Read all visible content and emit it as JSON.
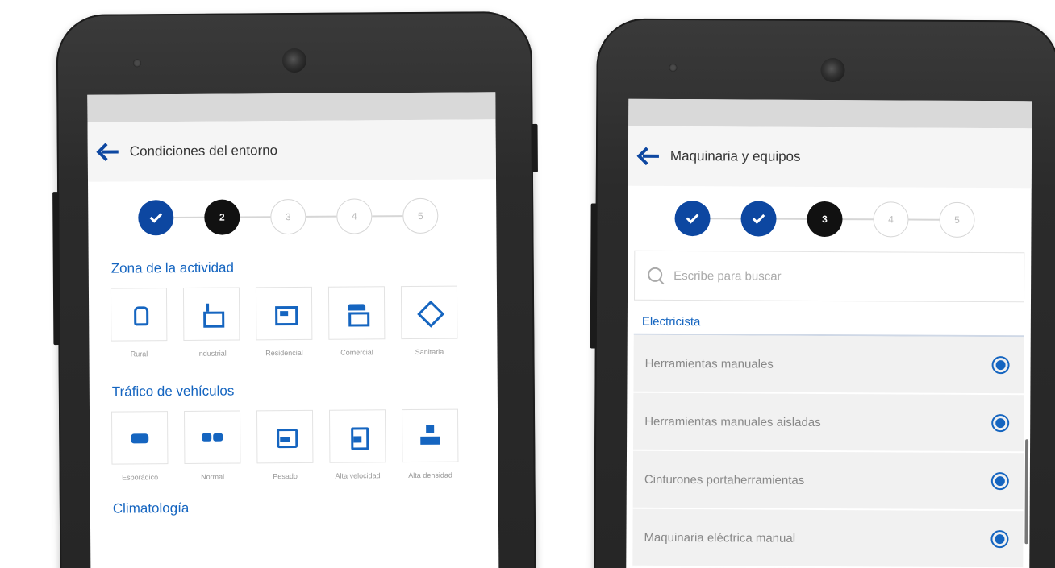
{
  "left_screen": {
    "title": "Condiciones del entorno",
    "steps": [
      "",
      "2",
      "3",
      "4",
      "5"
    ],
    "section1_title": "Zona de la actividad",
    "zona_tiles": [
      {
        "label": "Rural",
        "icon": "rural-icon"
      },
      {
        "label": "Industrial",
        "icon": "industrial-icon"
      },
      {
        "label": "Residencial",
        "icon": "residencial-icon"
      },
      {
        "label": "Comercial",
        "icon": "comercial-icon"
      },
      {
        "label": "Sanitaria",
        "icon": "sanitaria-icon"
      }
    ],
    "section2_title": "Tráfico de vehículos",
    "trafico_tiles": [
      {
        "label": "Esporádico",
        "icon": "car-icon"
      },
      {
        "label": "Normal",
        "icon": "cars-icon"
      },
      {
        "label": "Pesado",
        "icon": "truck-icon"
      },
      {
        "label": "Alta velocidad",
        "icon": "fast-car-icon"
      },
      {
        "label": "Alta densidad",
        "icon": "traffic-stack-icon"
      }
    ],
    "section3_title": "Climatología"
  },
  "right_screen": {
    "title": "Maquinaria y equipos",
    "steps": [
      "",
      "",
      "3",
      "4",
      "5"
    ],
    "search_placeholder": "Escribe para buscar",
    "category": "Electricista",
    "items": [
      "Herramientas manuales",
      "Herramientas manuales aisladas",
      "Cinturones portaherramientas",
      "Maquinaria eléctrica manual"
    ]
  },
  "colors": {
    "accent": "#1565c0",
    "step_done": "#0d47a1",
    "step_active": "#111111"
  }
}
